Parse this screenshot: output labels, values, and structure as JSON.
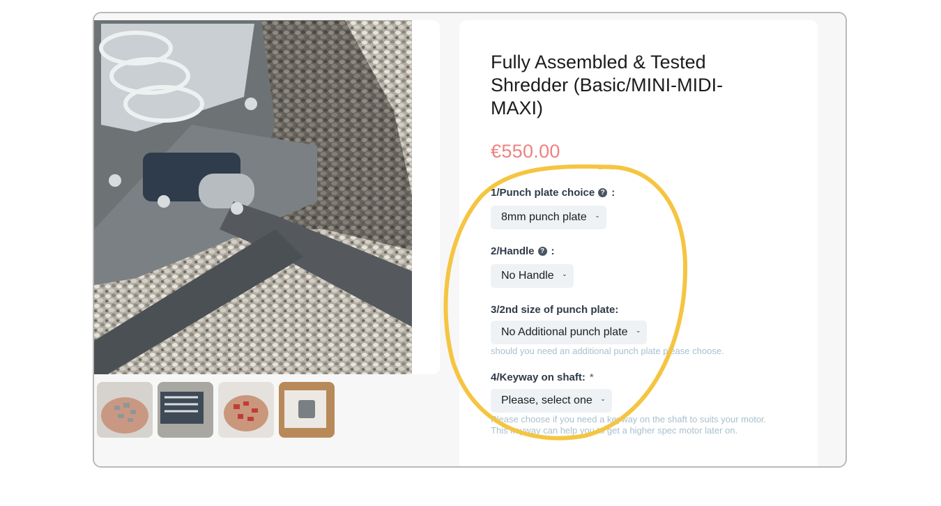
{
  "product": {
    "title": "Fully Assembled & Tested Shredder (Basic/MINI-MIDI-MAXI)",
    "price": "€550.00"
  },
  "options": [
    {
      "label": "1/Punch plate choice",
      "help": "?",
      "colon": ":",
      "selected": "8mm punch plate",
      "icon": "question-circle-icon"
    },
    {
      "label": "2/Handle",
      "help": "?",
      "colon": ":",
      "selected": "No Handle",
      "icon": "question-circle-icon"
    },
    {
      "label": "3/2nd size of punch plate:",
      "selected": "No Additional punch plate",
      "hint": "should you need an additional punch plate please choose."
    },
    {
      "label": "4/Keyway on shaft:",
      "required": "*",
      "selected": "Please, select one",
      "hint": "Please choose if you need a keyway on the shaft to suits your motor. This keyway can help you to get a higher spec motor later on."
    }
  ],
  "gallery": {
    "main_image": "shredder-on-gravel-photo",
    "thumbnails": [
      "shredded-plastic-flakes-photo",
      "shredder-unit-photo",
      "red-plastic-flakes-photo",
      "shredder-box-photo"
    ]
  },
  "annotation": {
    "color": "#f5c542",
    "shape": "hand-drawn-circle"
  },
  "colors": {
    "price": "#ef8181",
    "select_bg": "#eef2f5",
    "hint": "#a9c0cf",
    "frame_border": "#b9b9b9"
  }
}
